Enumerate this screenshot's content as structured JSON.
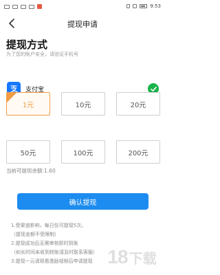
{
  "status_bar": {
    "time": "9:53"
  },
  "nav": {
    "title": "提现申请"
  },
  "header": {
    "title": "提现方式",
    "subtitle": "为了您的账户安全，请验证手机号"
  },
  "payment_method": {
    "label": "支付宝",
    "icon": "alipay-icon",
    "selected": true,
    "brand_color": "#1677ff",
    "check_color": "#18b34a"
  },
  "amounts": [
    {
      "label": "1元",
      "selected": true
    },
    {
      "label": "10元",
      "selected": false
    },
    {
      "label": "20元",
      "selected": false
    },
    {
      "label": "50元",
      "selected": false
    },
    {
      "label": "100元",
      "selected": false
    },
    {
      "label": "200元",
      "selected": false
    }
  ],
  "balance": "当前可提现余额:1.60",
  "confirm_label": "确认提现",
  "notes": [
    "1.受渠道影响，每日仅可提现5次。",
    "（提现金额不受限制）",
    "2.提现成功后无需审核即时到账",
    "（如长时间未收到转账请及时联系客服）",
    "3.提现一元请观看激励视频后申请提现"
  ],
  "watermark": {
    "number": "18",
    "text": "下载"
  },
  "colors": {
    "accent": "#1c8cf0",
    "selected_amount": "#f29b43"
  }
}
